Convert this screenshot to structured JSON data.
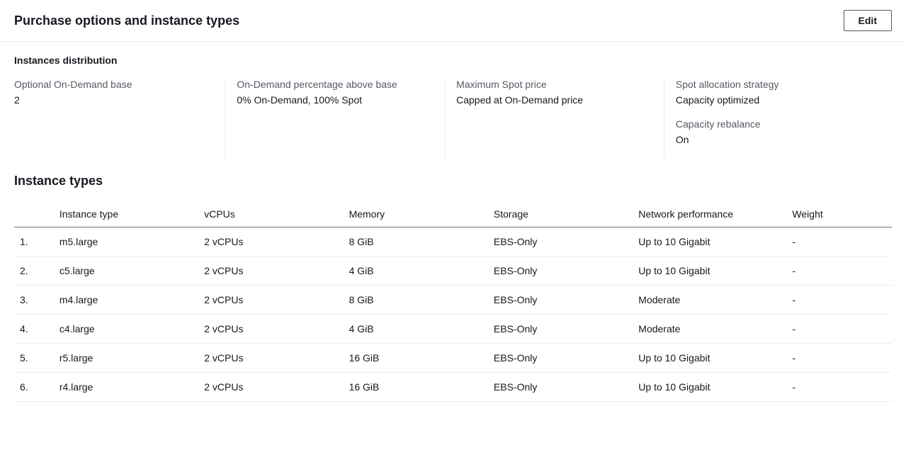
{
  "header": {
    "title": "Purchase options and instance types",
    "edit_label": "Edit"
  },
  "distribution": {
    "section_title": "Instances distribution",
    "items": [
      {
        "groups": [
          {
            "label": "Optional On-Demand base",
            "value": "2"
          }
        ]
      },
      {
        "groups": [
          {
            "label": "On-Demand percentage above base",
            "value": "0% On-Demand, 100% Spot"
          }
        ]
      },
      {
        "groups": [
          {
            "label": "Maximum Spot price",
            "value": "Capped at On-Demand price"
          }
        ]
      },
      {
        "groups": [
          {
            "label": "Spot allocation strategy",
            "value": "Capacity optimized"
          },
          {
            "label": "Capacity rebalance",
            "value": "On"
          }
        ]
      }
    ]
  },
  "instance_types": {
    "section_title": "Instance types",
    "headers": {
      "index": "",
      "instance_type": "Instance type",
      "vcpus": "vCPUs",
      "memory": "Memory",
      "storage": "Storage",
      "network": "Network performance",
      "weight": "Weight"
    },
    "rows": [
      {
        "index": "1.",
        "instance_type": "m5.large",
        "vcpus": "2 vCPUs",
        "memory": "8 GiB",
        "storage": "EBS-Only",
        "network": "Up to 10 Gigabit",
        "weight": "-"
      },
      {
        "index": "2.",
        "instance_type": "c5.large",
        "vcpus": "2 vCPUs",
        "memory": "4 GiB",
        "storage": "EBS-Only",
        "network": "Up to 10 Gigabit",
        "weight": "-"
      },
      {
        "index": "3.",
        "instance_type": "m4.large",
        "vcpus": "2 vCPUs",
        "memory": "8 GiB",
        "storage": "EBS-Only",
        "network": "Moderate",
        "weight": "-"
      },
      {
        "index": "4.",
        "instance_type": "c4.large",
        "vcpus": "2 vCPUs",
        "memory": "4 GiB",
        "storage": "EBS-Only",
        "network": "Moderate",
        "weight": "-"
      },
      {
        "index": "5.",
        "instance_type": "r5.large",
        "vcpus": "2 vCPUs",
        "memory": "16 GiB",
        "storage": "EBS-Only",
        "network": "Up to 10 Gigabit",
        "weight": "-"
      },
      {
        "index": "6.",
        "instance_type": "r4.large",
        "vcpus": "2 vCPUs",
        "memory": "16 GiB",
        "storage": "EBS-Only",
        "network": "Up to 10 Gigabit",
        "weight": "-"
      }
    ]
  }
}
